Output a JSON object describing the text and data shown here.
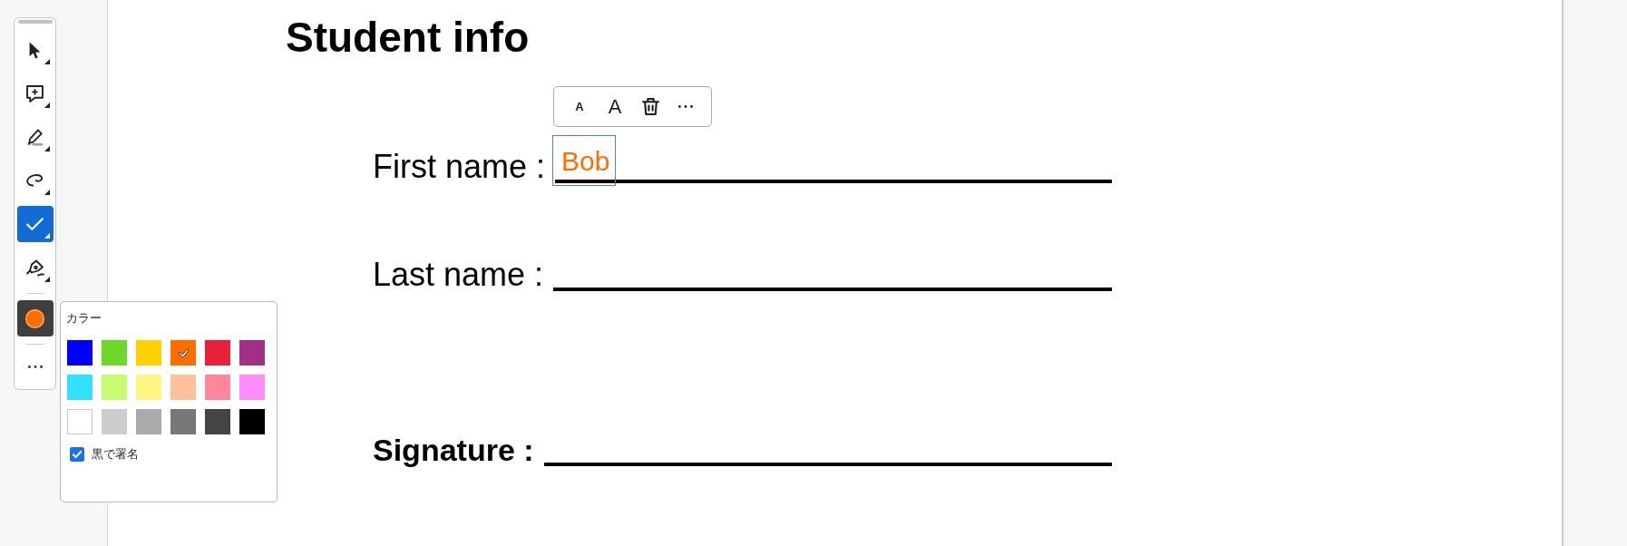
{
  "toolbar": {
    "tools": [
      {
        "kind": "select",
        "selected": false
      },
      {
        "kind": "comment",
        "selected": false
      },
      {
        "kind": "highlight",
        "selected": false
      },
      {
        "kind": "draw",
        "selected": false
      },
      {
        "kind": "check",
        "selected": true
      },
      {
        "kind": "sign",
        "selected": false
      }
    ]
  },
  "color_popup": {
    "title": "カラー",
    "swatches": [
      {
        "color": "#0000ff",
        "selected": false
      },
      {
        "color": "#6cd92a",
        "selected": false
      },
      {
        "color": "#ffd100",
        "selected": false
      },
      {
        "color": "#ff6d00",
        "selected": true
      },
      {
        "color": "#e8213b",
        "selected": false
      },
      {
        "color": "#a32f87",
        "selected": false
      },
      {
        "color": "#33e1ff",
        "selected": false
      },
      {
        "color": "#c8fb74",
        "selected": false
      },
      {
        "color": "#fff383",
        "selected": false
      },
      {
        "color": "#ffc09d",
        "selected": false
      },
      {
        "color": "#ff869f",
        "selected": false
      },
      {
        "color": "#ff8dfc",
        "selected": false
      },
      {
        "color": "#ffffff",
        "selected": false
      },
      {
        "color": "#cccccc",
        "selected": false
      },
      {
        "color": "#aaaaaa",
        "selected": false
      },
      {
        "color": "#777777",
        "selected": false
      },
      {
        "color": "#444444",
        "selected": false
      },
      {
        "color": "#000000",
        "selected": false
      }
    ],
    "sign_in_black": {
      "label": "黒で署名",
      "checked": true
    }
  },
  "document": {
    "title": "Student info",
    "fields": [
      {
        "kind": "text",
        "label": "First name :",
        "annotation": {
          "text": "Bob",
          "selected": true,
          "toolbar": [
            {
              "kind": "smaller",
              "label": "A"
            },
            {
              "kind": "larger",
              "label": "A"
            },
            {
              "kind": "delete"
            },
            {
              "kind": "more"
            }
          ]
        }
      },
      {
        "kind": "text",
        "label": "Last name :"
      },
      {
        "kind": "signature",
        "label": "Signature :"
      }
    ]
  }
}
